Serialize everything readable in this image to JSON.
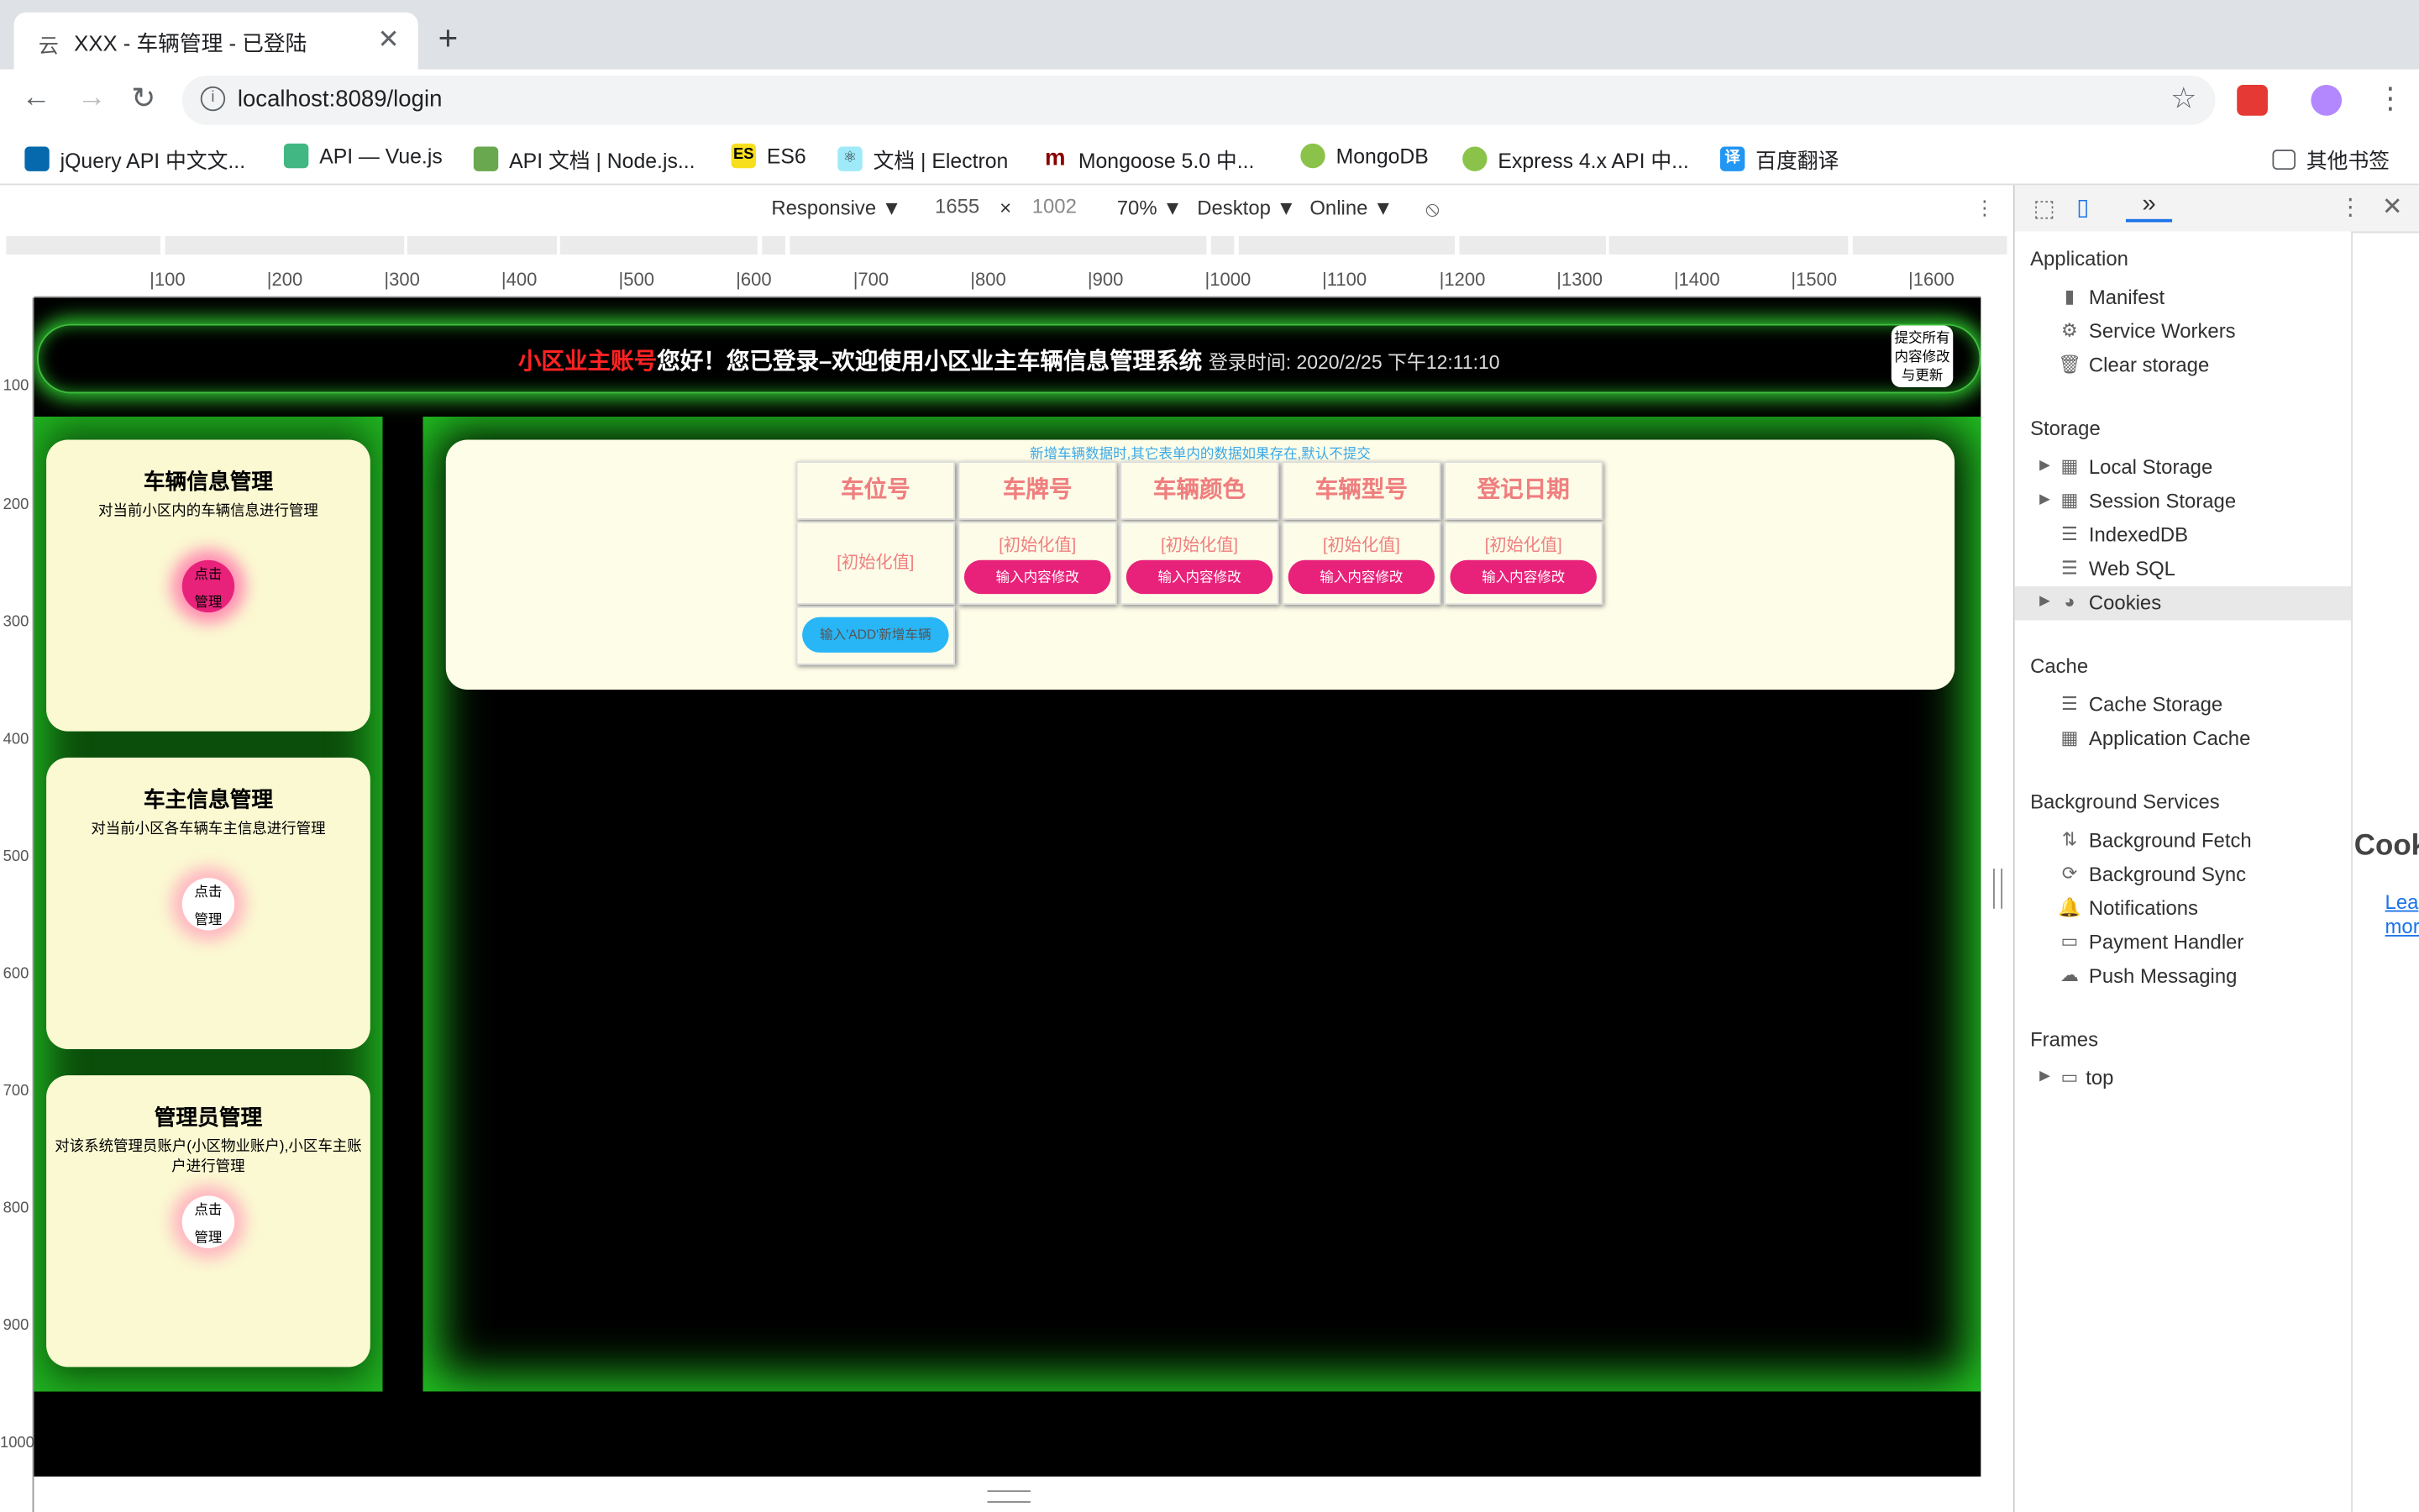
{
  "browser": {
    "tab": {
      "favicon": "云",
      "title": "XXX - 车辆管理 - 已登陆",
      "close": "✕"
    },
    "new_tab": "+",
    "url": "localhost:8089/login",
    "bookmarks": [
      {
        "label": "jQuery API 中文文...",
        "icon": "jquery-icon"
      },
      {
        "label": "API — Vue.js",
        "icon": "vue-icon"
      },
      {
        "label": "API 文档 | Node.js...",
        "icon": "nodejs-icon"
      },
      {
        "label": "ES6",
        "icon": "es-icon"
      },
      {
        "label": "文档 | Electron",
        "icon": "electron-icon"
      },
      {
        "label": "Mongoose 5.0 中...",
        "icon": "mongoose-icon"
      },
      {
        "label": "MongoDB",
        "icon": "mongodb-icon"
      },
      {
        "label": "Express 4.x API 中...",
        "icon": "express-icon"
      },
      {
        "label": "百度翻译",
        "icon": "translate-icon"
      },
      {
        "label": "其他书签",
        "icon": "folder-icon"
      }
    ]
  },
  "device_toolbar": {
    "mode": "Responsive ▼",
    "width": "1655",
    "times": "×",
    "height": "1002",
    "zoom": "70% ▼",
    "device": "Desktop ▼",
    "network": "Online ▼"
  },
  "ruler": {
    "h": [
      "|100",
      "|200",
      "|300",
      "|400",
      "|500",
      "|600",
      "|700",
      "|800",
      "|900",
      "|1000",
      "|1100",
      "|1200",
      "|1300",
      "|1400",
      "|1500",
      "|1600"
    ],
    "v": [
      "100",
      "200",
      "300",
      "400",
      "500",
      "600",
      "700",
      "800",
      "900",
      "1000"
    ]
  },
  "app": {
    "header": {
      "account": "小区业主账号",
      "welcome": "您好！您已登录–欢迎使用小区业主车辆信息管理系统",
      "time": "登录时间: 2020/2/25 下午12:11:10",
      "submit_btn": "提交所有内容修改与更新"
    },
    "cards": [
      {
        "title": "车辆信息管理",
        "desc": "对当前小区内的车辆信息进行管理",
        "btn_line1": "点击",
        "btn_line2": "管理"
      },
      {
        "title": "车主信息管理",
        "desc": "对当前小区各车辆车主信息进行管理",
        "btn_line1": "点击",
        "btn_line2": "管理"
      },
      {
        "title": "管理员管理",
        "desc": "对该系统管理员账户(小区物业账户),小区车主账户进行管理",
        "btn_line1": "点击",
        "btn_line2": "管理"
      }
    ],
    "note": "新增车辆数据时,其它表单内的数据如果存在,默认不提交",
    "table": {
      "headers": [
        "车位号",
        "车牌号",
        "车辆颜色",
        "车辆型号",
        "登记日期"
      ],
      "init": [
        "[初始化值]",
        "[初始化值]",
        "[初始化值]",
        "[初始化值]",
        "[初始化值]"
      ],
      "edit_btn": "输入内容修改",
      "add_btn": "输入'ADD'新增车辆"
    }
  },
  "devtools": {
    "tab_more": "»",
    "sections": [
      {
        "title": "Application",
        "items": [
          "Manifest",
          "Service Workers",
          "Clear storage"
        ]
      },
      {
        "title": "Storage",
        "items": [
          "Local Storage",
          "Session Storage",
          "IndexedDB",
          "Web SQL",
          "Cookies"
        ]
      },
      {
        "title": "Cache",
        "items": [
          "Cache Storage",
          "Application Cache"
        ]
      },
      {
        "title": "Background Services",
        "items": [
          "Background Fetch",
          "Background Sync",
          "Notifications",
          "Payment Handler",
          "Push Messaging"
        ]
      },
      {
        "title": "Frames",
        "items": [
          "top"
        ]
      }
    ],
    "right_title": "Cook",
    "right_link1": "Lea",
    "right_link2": "mor"
  }
}
